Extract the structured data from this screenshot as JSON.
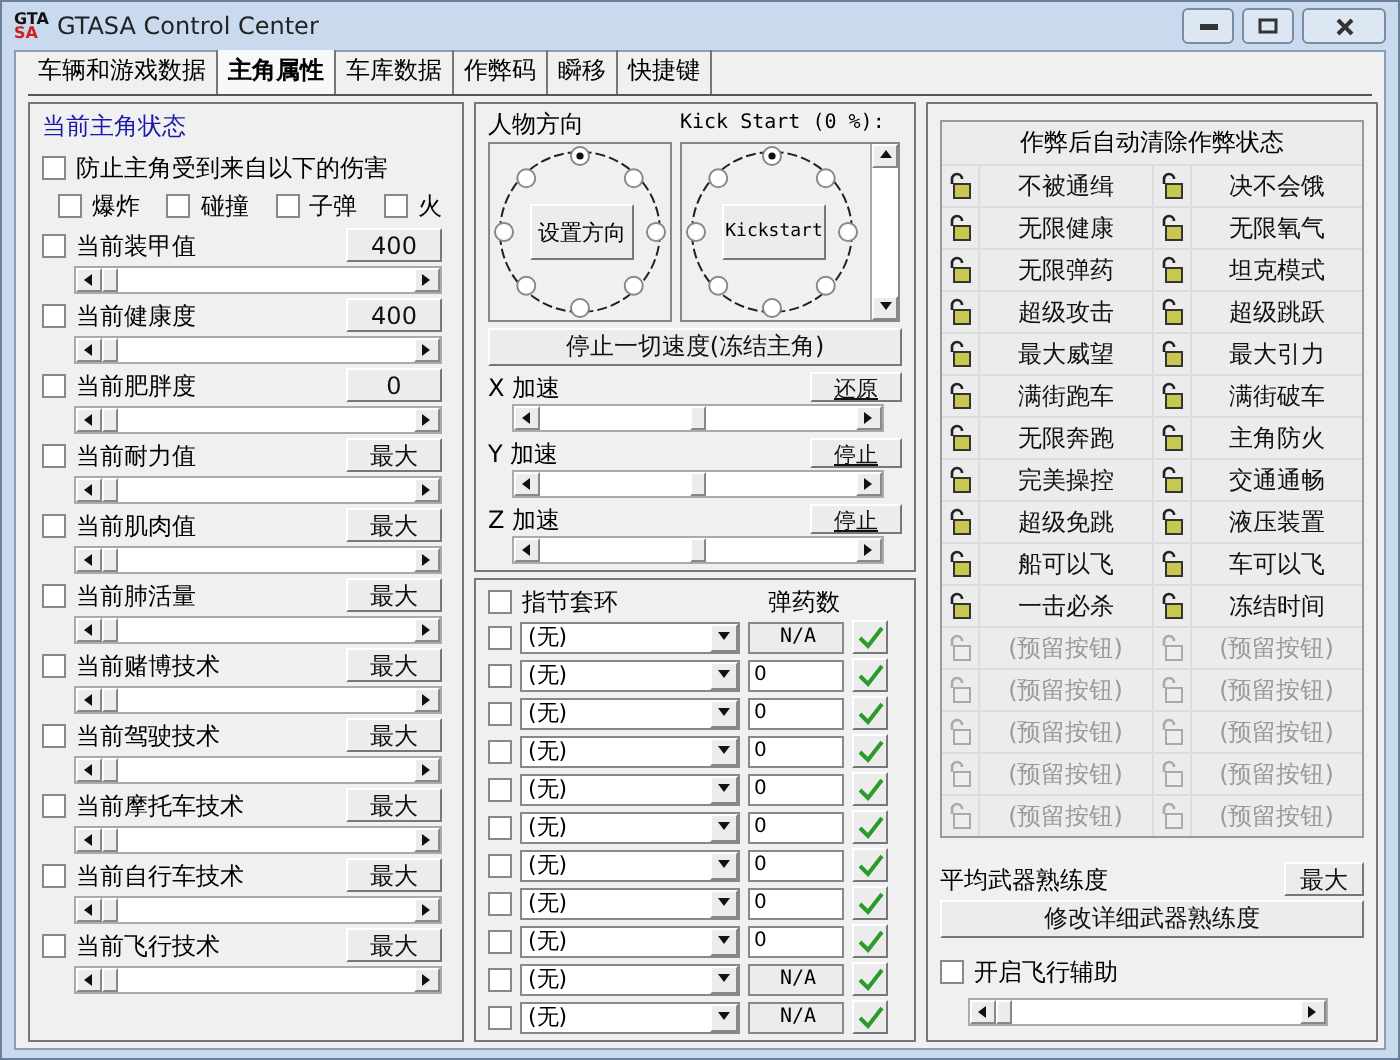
{
  "window": {
    "logo": [
      "GTA",
      "SA"
    ],
    "title": "GTASA Control Center"
  },
  "tabs": [
    {
      "label": "车辆和游戏数据",
      "selected": false
    },
    {
      "label": "主角属性",
      "selected": true
    },
    {
      "label": "车库数据",
      "selected": false
    },
    {
      "label": "作弊码",
      "selected": false
    },
    {
      "label": "瞬移",
      "selected": false
    },
    {
      "label": "快捷键",
      "selected": false
    }
  ],
  "left": {
    "title": "当前主角状态",
    "protect": {
      "label": "防止主角受到来自以下的伤害",
      "checked": false
    },
    "damage_types": [
      {
        "label": "爆炸",
        "checked": false
      },
      {
        "label": "碰撞",
        "checked": false
      },
      {
        "label": "子弹",
        "checked": false
      },
      {
        "label": "火",
        "checked": false
      }
    ],
    "stats": [
      {
        "label": "当前装甲值",
        "checked": false,
        "value": "400"
      },
      {
        "label": "当前健康度",
        "checked": false,
        "value": "400"
      },
      {
        "label": "当前肥胖度",
        "checked": false,
        "value": "0"
      },
      {
        "label": "当前耐力值",
        "checked": false,
        "value": "最大"
      },
      {
        "label": "当前肌肉值",
        "checked": false,
        "value": "最大"
      },
      {
        "label": "当前肺活量",
        "checked": false,
        "value": "最大"
      },
      {
        "label": "当前赌博技术",
        "checked": false,
        "value": "最大"
      },
      {
        "label": "当前驾驶技术",
        "checked": false,
        "value": "最大"
      },
      {
        "label": "当前摩托车技术",
        "checked": false,
        "value": "最大"
      },
      {
        "label": "当前自行车技术",
        "checked": false,
        "value": "最大"
      },
      {
        "label": "当前飞行技术",
        "checked": false,
        "value": "最大"
      }
    ]
  },
  "middle": {
    "dials": [
      {
        "label": "人物方向",
        "button": "设置方向",
        "positions": [
          {
            "selected": true
          },
          {
            "selected": false
          },
          {
            "selected": false
          },
          {
            "selected": false
          },
          {
            "selected": false
          },
          {
            "selected": false
          },
          {
            "selected": false
          },
          {
            "selected": false
          }
        ]
      },
      {
        "label": "Kick Start (0 %):",
        "button": "Kickstart",
        "positions": [
          {
            "selected": true
          },
          {
            "selected": false
          },
          {
            "selected": false
          },
          {
            "selected": false
          },
          {
            "selected": false
          },
          {
            "selected": false
          },
          {
            "selected": false
          },
          {
            "selected": false
          }
        ]
      }
    ],
    "stop_button": "停止一切速度(冻结主角)",
    "accels": [
      {
        "label": "X 加速",
        "button": "还原",
        "level": 0.5
      },
      {
        "label": "Y 加速",
        "button": "停止",
        "level": 0.5
      },
      {
        "label": "Z 加速",
        "button": "停止",
        "level": 0.5
      }
    ],
    "knuckles": {
      "label": "指节套环",
      "checked": false
    },
    "ammo_header": "弹药数",
    "weapons": [
      {
        "checked": false,
        "weapon": "(无)",
        "ammo": "N/A",
        "disabled": true
      },
      {
        "checked": false,
        "weapon": "(无)",
        "ammo": "0",
        "disabled": false
      },
      {
        "checked": false,
        "weapon": "(无)",
        "ammo": "0",
        "disabled": false
      },
      {
        "checked": false,
        "weapon": "(无)",
        "ammo": "0",
        "disabled": false
      },
      {
        "checked": false,
        "weapon": "(无)",
        "ammo": "0",
        "disabled": false
      },
      {
        "checked": false,
        "weapon": "(无)",
        "ammo": "0",
        "disabled": false
      },
      {
        "checked": false,
        "weapon": "(无)",
        "ammo": "0",
        "disabled": false
      },
      {
        "checked": false,
        "weapon": "(无)",
        "ammo": "0",
        "disabled": false
      },
      {
        "checked": false,
        "weapon": "(无)",
        "ammo": "0",
        "disabled": false
      },
      {
        "checked": false,
        "weapon": "(无)",
        "ammo": "N/A",
        "disabled": true
      },
      {
        "checked": false,
        "weapon": "(无)",
        "ammo": "N/A",
        "disabled": true
      }
    ]
  },
  "right": {
    "header": "作弊后自动清除作弊状态",
    "cheats": [
      {
        "label": "不被通缉",
        "disabled": false
      },
      {
        "label": "决不会饿",
        "disabled": false
      },
      {
        "label": "无限健康",
        "disabled": false
      },
      {
        "label": "无限氧气",
        "disabled": false
      },
      {
        "label": "无限弹药",
        "disabled": false
      },
      {
        "label": "坦克模式",
        "disabled": false
      },
      {
        "label": "超级攻击",
        "disabled": false
      },
      {
        "label": "超级跳跃",
        "disabled": false
      },
      {
        "label": "最大威望",
        "disabled": false
      },
      {
        "label": "最大引力",
        "disabled": false
      },
      {
        "label": "满街跑车",
        "disabled": false
      },
      {
        "label": "满街破车",
        "disabled": false
      },
      {
        "label": "无限奔跑",
        "disabled": false
      },
      {
        "label": "主角防火",
        "disabled": false
      },
      {
        "label": "完美操控",
        "disabled": false
      },
      {
        "label": "交通通畅",
        "disabled": false
      },
      {
        "label": "超级免跳",
        "disabled": false
      },
      {
        "label": "液压装置",
        "disabled": false
      },
      {
        "label": "船可以飞",
        "disabled": false
      },
      {
        "label": "车可以飞",
        "disabled": false
      },
      {
        "label": "一击必杀",
        "disabled": false
      },
      {
        "label": "冻结时间",
        "disabled": false
      },
      {
        "label": "(预留按钮)",
        "disabled": true
      },
      {
        "label": "(预留按钮)",
        "disabled": true
      },
      {
        "label": "(预留按钮)",
        "disabled": true
      },
      {
        "label": "(预留按钮)",
        "disabled": true
      },
      {
        "label": "(预留按钮)",
        "disabled": true
      },
      {
        "label": "(预留按钮)",
        "disabled": true
      },
      {
        "label": "(预留按钮)",
        "disabled": true
      },
      {
        "label": "(预留按钮)",
        "disabled": true
      },
      {
        "label": "(预留按钮)",
        "disabled": true
      },
      {
        "label": "(预留按钮)",
        "disabled": true
      }
    ],
    "avg_label": "平均武器熟练度",
    "avg_button": "最大",
    "detail_button": "修改详细武器熟练度",
    "flight": {
      "label": "开启飞行辅助",
      "checked": false
    }
  }
}
